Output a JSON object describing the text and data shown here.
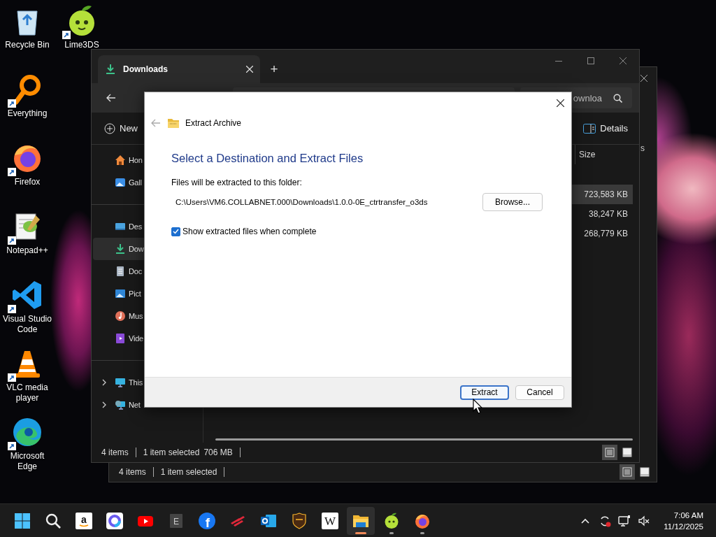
{
  "desktop": {
    "columns": [
      {
        "icons": [
          {
            "kind": "recycle",
            "label": "Recycle Bin",
            "shortcut": false
          },
          {
            "kind": "everything",
            "label": "Everything",
            "shortcut": true
          },
          {
            "kind": "firefox",
            "label": "Firefox",
            "shortcut": true
          },
          {
            "kind": "notepad",
            "label": "Notepad++",
            "shortcut": true
          },
          {
            "kind": "vscode",
            "label": "Visual Studio Code",
            "shortcut": true
          },
          {
            "kind": "vlc",
            "label": "VLC media player",
            "shortcut": true
          },
          {
            "kind": "edge",
            "label": "Microsoft Edge",
            "shortcut": true
          }
        ]
      },
      {
        "icons": [
          {
            "kind": "lime",
            "label": "Lime3DS",
            "shortcut": true
          }
        ]
      }
    ]
  },
  "back_window": {
    "column_header": "s",
    "status_bar": {
      "item_count": "4 items",
      "selection": "1 item selected"
    },
    "views": [
      {
        "kind": "details",
        "selected": true
      },
      {
        "kind": "tiles",
        "selected": false
      }
    ]
  },
  "explorer": {
    "tabs": [
      {
        "title": "Downloads",
        "selected": true
      }
    ],
    "new_tab": "+",
    "search": {
      "placeholder": "ownloa"
    },
    "commands": {
      "new": "New",
      "details": "Details"
    },
    "nav_groups": [
      {
        "items": [
          {
            "kind": "home",
            "label": "Hon",
            "selected": false
          },
          {
            "kind": "gallery",
            "label": "Gall",
            "selected": false
          }
        ]
      },
      {
        "items": [
          {
            "kind": "desktop",
            "label": "Des",
            "selected": false
          },
          {
            "kind": "downloads",
            "label": "Dow",
            "selected": true
          },
          {
            "kind": "documents",
            "label": "Doc",
            "selected": false
          },
          {
            "kind": "pictures",
            "label": "Pict",
            "selected": false
          },
          {
            "kind": "music",
            "label": "Mus",
            "selected": false
          },
          {
            "kind": "videos",
            "label": "Vide",
            "selected": false
          }
        ]
      },
      {
        "items": [
          {
            "kind": "pc",
            "label": "This",
            "selected": false,
            "expanded": false
          },
          {
            "kind": "network",
            "label": "Net",
            "selected": false,
            "expanded": false
          }
        ]
      }
    ],
    "columns": [
      {
        "label": "Size"
      }
    ],
    "rows": [
      {
        "size": "723,583 KB",
        "selected": true
      },
      {
        "size": "38,247 KB",
        "selected": false
      },
      {
        "size": "268,779 KB",
        "selected": false
      }
    ],
    "status_bar": {
      "item_count": "4 items",
      "selection": "1 item selected",
      "selection_size": "706 MB"
    },
    "views": [
      {
        "kind": "details",
        "selected": true
      },
      {
        "kind": "tiles",
        "selected": false
      }
    ]
  },
  "dialog": {
    "title": "Extract Archive",
    "heading": "Select a Destination and Extract Files",
    "destination_label": "Files will be extracted to this folder:",
    "path": "C:\\Users\\VM6.COLLABNET.000\\Downloads\\1.0.0-0E_ctrtransfer_o3ds",
    "browse": "Browse...",
    "show_files": {
      "label": "Show extracted files when complete",
      "checked": true
    },
    "buttons": [
      {
        "label": "Extract",
        "focused": true
      },
      {
        "label": "Cancel",
        "focused": false
      }
    ]
  },
  "taskbar": {
    "apps": [
      {
        "kind": "start",
        "selected": false,
        "running": false
      },
      {
        "kind": "search",
        "selected": false,
        "running": false
      },
      {
        "kind": "amazon",
        "glyph": "a",
        "selected": false,
        "running": false
      },
      {
        "kind": "copilot",
        "selected": false,
        "running": false
      },
      {
        "kind": "youtube",
        "selected": false,
        "running": false
      },
      {
        "kind": "epic",
        "glyph": "E",
        "selected": false,
        "running": false
      },
      {
        "kind": "facebook",
        "glyph": "f",
        "selected": false,
        "running": false
      },
      {
        "kind": "stripes",
        "selected": false,
        "running": false
      },
      {
        "kind": "outlook",
        "selected": false,
        "running": false
      },
      {
        "kind": "ups",
        "selected": false,
        "running": false
      },
      {
        "kind": "wiki",
        "glyph": "W",
        "selected": false,
        "running": false
      },
      {
        "kind": "explorer",
        "selected": true,
        "running": true
      },
      {
        "kind": "lime",
        "selected": false,
        "running": true
      },
      {
        "kind": "firefox",
        "selected": false,
        "running": true
      }
    ],
    "clock": {
      "time": "7:06 AM",
      "date": "11/12/2025"
    }
  }
}
